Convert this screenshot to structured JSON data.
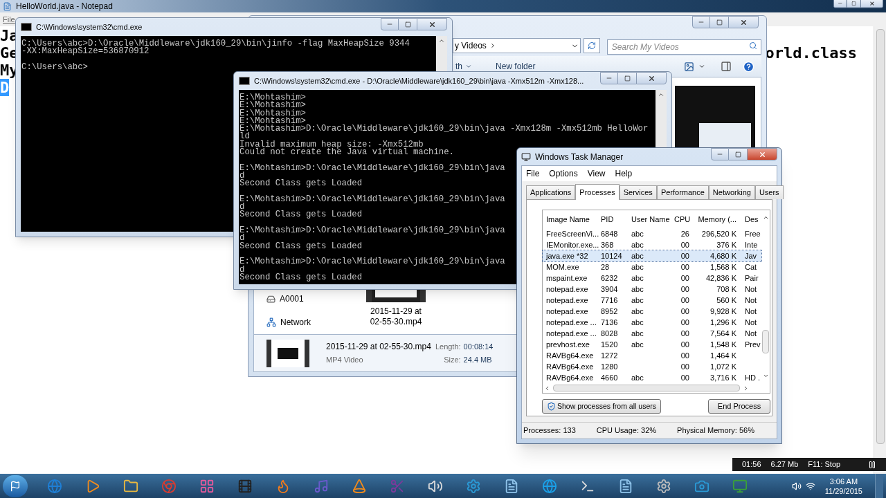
{
  "notepad": {
    "title": "HelloWorld.java - Notepad",
    "menu": [
      "File"
    ],
    "lines": [
      {
        "left": "Ja",
        "highlighted": false
      },
      {
        "left": "Ge",
        "right": "orld.class",
        "highlighted": false
      },
      {
        "left": "My",
        "highlighted": false
      },
      {
        "left": "D",
        "highlighted": true
      }
    ]
  },
  "explorer": {
    "address": "y Videos",
    "search_placeholder": "Search My Videos",
    "toolbar": [
      "th",
      "New folder"
    ],
    "nav_items": [
      "A0001",
      "Network"
    ],
    "file": {
      "name": "2015-11-29 at 02-55-30.mp4"
    },
    "details": {
      "name": "2015-11-29 at 02-55-30.mp4",
      "type": "MP4 Video",
      "length_label": "Length:",
      "length": "00:08:14",
      "size_label": "Size:",
      "size": "24.4 MB"
    }
  },
  "cmd_windows": [
    {
      "title": "C:\\Windows\\system32\\cmd.exe",
      "blocks": [
        [
          "C:\\Users\\abc>D:\\Oracle\\Middleware\\jdk160_29\\bin\\jinfo -flag MaxHeapSize 9344",
          "-XX:MaxHeapSize=536870912"
        ],
        [
          "C:\\Users\\abc>"
        ]
      ]
    },
    {
      "title": "C:\\Windows\\system32\\cmd.exe - D:\\Oracle\\Middleware\\jdk160_29\\bin\\java  -Xmx512m -Xmx128...",
      "blocks": [
        [
          "E:\\Mohtashim>",
          "E:\\Mohtashim>",
          "E:\\Mohtashim>",
          "E:\\Mohtashim>",
          "E:\\Mohtashim>D:\\Oracle\\Middleware\\jdk160_29\\bin\\java -Xmx128m -Xmx512mb HelloWor",
          "ld",
          "Invalid maximum heap size: -Xmx512mb",
          "Could not create the Java virtual machine."
        ],
        [
          "E:\\Mohtashim>D:\\Oracle\\Middleware\\jdk160_29\\bin\\java",
          "d",
          "Second Class gets Loaded"
        ],
        [
          "E:\\Mohtashim>D:\\Oracle\\Middleware\\jdk160_29\\bin\\java",
          "d",
          "Second Class gets Loaded"
        ],
        [
          "E:\\Mohtashim>D:\\Oracle\\Middleware\\jdk160_29\\bin\\java",
          "d",
          "Second Class gets Loaded"
        ],
        [
          "E:\\Mohtashim>D:\\Oracle\\Middleware\\jdk160_29\\bin\\java",
          "d",
          "Second Class gets Loaded"
        ]
      ]
    }
  ],
  "task_manager": {
    "title": "Windows Task Manager",
    "menu": [
      "File",
      "Options",
      "View",
      "Help"
    ],
    "tabs": [
      {
        "label": "Applications",
        "selected": false
      },
      {
        "label": "Processes",
        "selected": true
      },
      {
        "label": "Services",
        "selected": false
      },
      {
        "label": "Performance",
        "selected": false
      },
      {
        "label": "Networking",
        "selected": false
      },
      {
        "label": "Users",
        "selected": false
      }
    ],
    "columns": [
      "Image Name",
      "PID",
      "User Name",
      "CPU",
      "Memory (...",
      "Des"
    ],
    "rows": [
      {
        "name": "FreeScreenVi...",
        "pid": "6848",
        "user": "abc",
        "cpu": "26",
        "memory": "296,520 K",
        "description": "Free",
        "selected": false
      },
      {
        "name": "IEMonitor.exe...",
        "pid": "368",
        "user": "abc",
        "cpu": "00",
        "memory": "376 K",
        "description": "Inte",
        "selected": false
      },
      {
        "name": "java.exe *32",
        "pid": "10124",
        "user": "abc",
        "cpu": "00",
        "memory": "4,680 K",
        "description": "Jav",
        "selected": true
      },
      {
        "name": "MOM.exe",
        "pid": "28",
        "user": "abc",
        "cpu": "00",
        "memory": "1,568 K",
        "description": "Cat",
        "selected": false
      },
      {
        "name": "mspaint.exe",
        "pid": "6232",
        "user": "abc",
        "cpu": "00",
        "memory": "42,836 K",
        "description": "Pair",
        "selected": false
      },
      {
        "name": "notepad.exe",
        "pid": "3904",
        "user": "abc",
        "cpu": "00",
        "memory": "708 K",
        "description": "Not",
        "selected": false
      },
      {
        "name": "notepad.exe",
        "pid": "7716",
        "user": "abc",
        "cpu": "00",
        "memory": "560 K",
        "description": "Not",
        "selected": false
      },
      {
        "name": "notepad.exe",
        "pid": "8952",
        "user": "abc",
        "cpu": "00",
        "memory": "9,928 K",
        "description": "Not",
        "selected": false
      },
      {
        "name": "notepad.exe ...",
        "pid": "7136",
        "user": "abc",
        "cpu": "00",
        "memory": "1,296 K",
        "description": "Not",
        "selected": false
      },
      {
        "name": "notepad.exe ...",
        "pid": "8028",
        "user": "abc",
        "cpu": "00",
        "memory": "7,564 K",
        "description": "Not",
        "selected": false
      },
      {
        "name": "prevhost.exe",
        "pid": "1520",
        "user": "abc",
        "cpu": "00",
        "memory": "1,548 K",
        "description": "Prev",
        "selected": false
      },
      {
        "name": "RAVBg64.exe",
        "pid": "1272",
        "cpu": "00",
        "memory": "1,464 K",
        "selected": false
      },
      {
        "name": "RAVBg64.exe",
        "pid": "1280",
        "cpu": "00",
        "memory": "1,072 K",
        "selected": false
      },
      {
        "name": "RAVBg64.exe",
        "pid": "4660",
        "user": "abc",
        "cpu": "00",
        "memory": "3,716 K",
        "description": "HD .",
        "selected": false
      }
    ],
    "buttons": [
      "Show processes from all users",
      "End Process"
    ],
    "status": [
      "Processes: 133",
      "CPU Usage: 32%",
      "Physical Memory: 56%"
    ]
  },
  "recorder": {
    "elapsed": "01:56",
    "size": "6.27 Mb",
    "stop": "F11: Stop"
  },
  "taskbar": {
    "time": "3:06 AM",
    "date": "11/29/2015"
  }
}
